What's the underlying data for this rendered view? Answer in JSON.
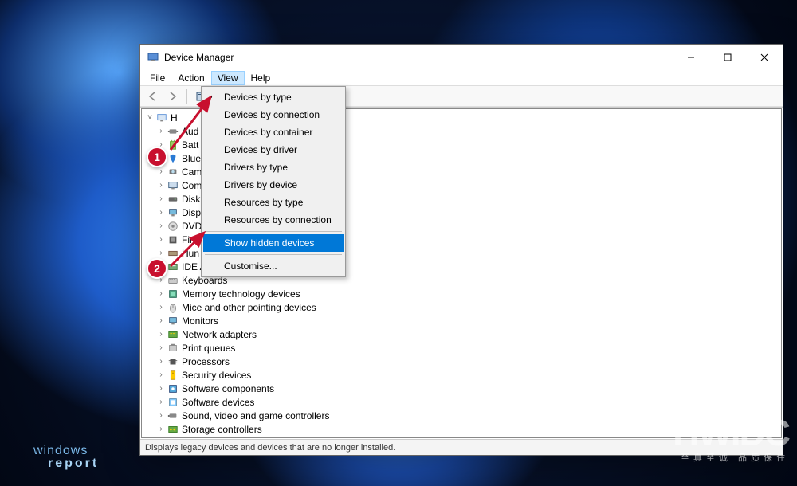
{
  "window": {
    "title": "Device Manager",
    "menus": {
      "file": "File",
      "action": "Action",
      "view": "View",
      "help": "Help"
    },
    "status": "Displays legacy devices and devices that are no longer installed."
  },
  "view_menu": {
    "items": [
      "Devices by type",
      "Devices by connection",
      "Devices by container",
      "Devices by driver",
      "Drivers by type",
      "Drivers by device",
      "Resources by type",
      "Resources by connection",
      "Show hidden devices",
      "Customise..."
    ],
    "checked_index": 0,
    "highlighted_index": 8
  },
  "tree": {
    "root": "H",
    "items": [
      "Aud",
      "Batt",
      "Blue",
      "Cam",
      "Com",
      "Disk",
      "Disp",
      "DVD",
      "Firm",
      "Hun",
      "IDE A",
      "Keyboards",
      "Memory technology devices",
      "Mice and other pointing devices",
      "Monitors",
      "Network adapters",
      "Print queues",
      "Processors",
      "Security devices",
      "Software components",
      "Software devices",
      "Sound, video and game controllers",
      "Storage controllers"
    ]
  },
  "annotations": {
    "badge1": "1",
    "badge2": "2"
  },
  "watermarks": {
    "wr_line1": "windows",
    "wr_line2": "report",
    "hwidc": "HWIDC",
    "hwidc_sub": "至真至诚 品质保住"
  }
}
